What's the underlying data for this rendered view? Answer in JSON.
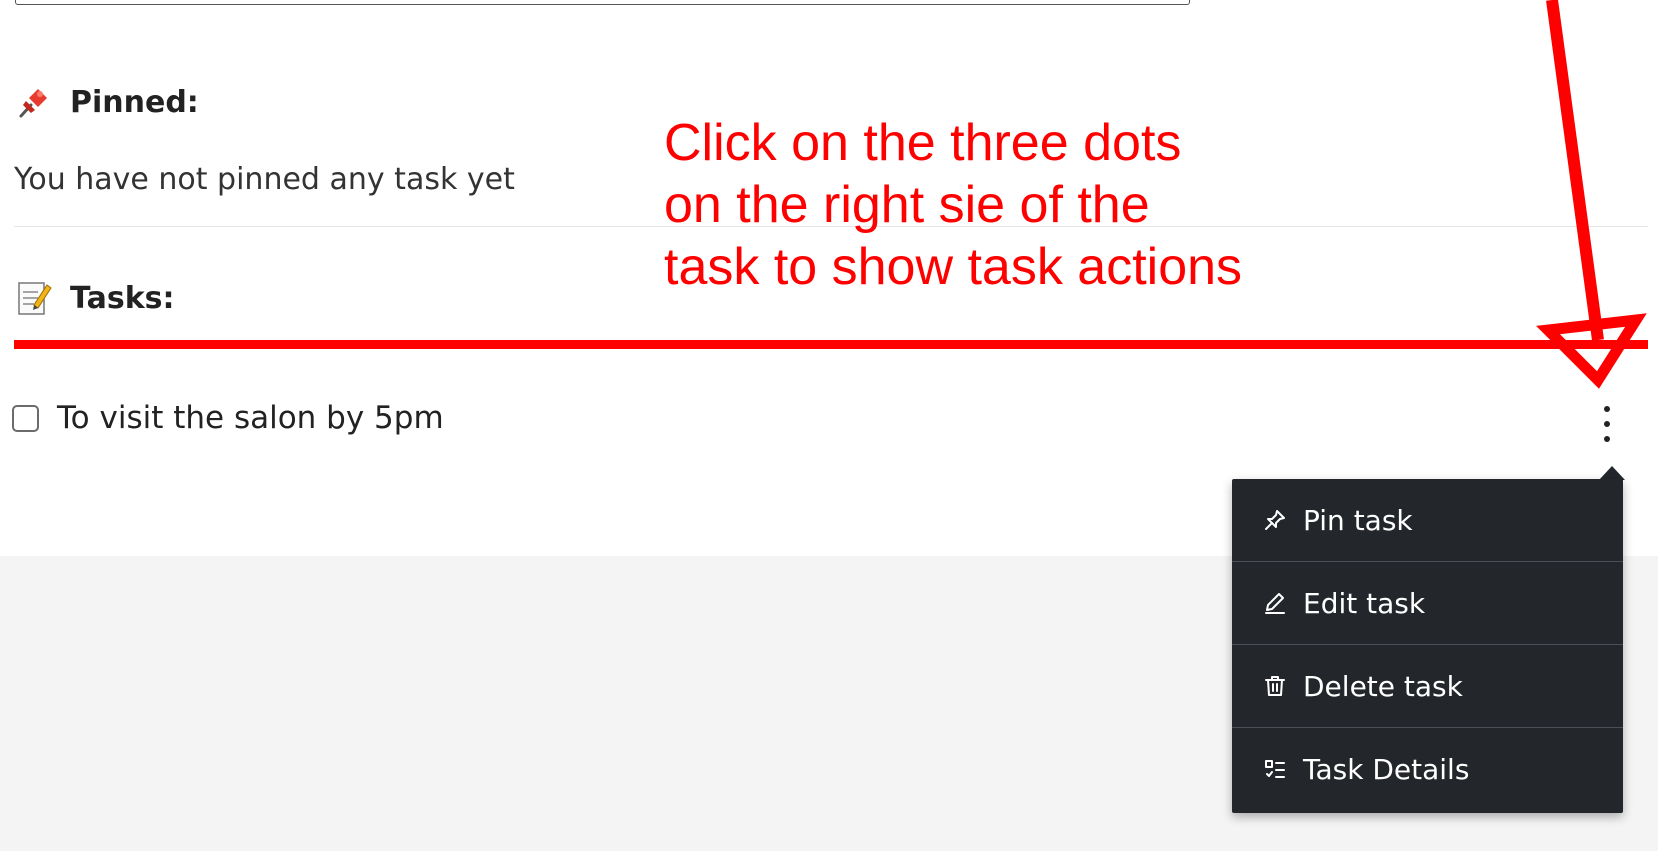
{
  "pinned": {
    "heading": "Pinned:",
    "empty_text": "You have not pinned any task yet"
  },
  "tasks": {
    "heading": "Tasks:",
    "items": [
      {
        "label": "To visit the salon by 5pm",
        "checked": false
      }
    ]
  },
  "annotation": {
    "lines": [
      "Click on the three dots",
      "on the right sie of the",
      "task to show task actions"
    ],
    "color": "#ff0000"
  },
  "task_menu": {
    "items": [
      {
        "label": "Pin task",
        "icon": "pin-icon"
      },
      {
        "label": "Edit task",
        "icon": "pencil-icon"
      },
      {
        "label": "Delete task",
        "icon": "trash-icon"
      },
      {
        "label": "Task Details",
        "icon": "checklist-icon"
      }
    ]
  },
  "colors": {
    "menu_background": "#23272b",
    "annotation": "#ff0000",
    "footer_background": "#f4f4f4"
  }
}
